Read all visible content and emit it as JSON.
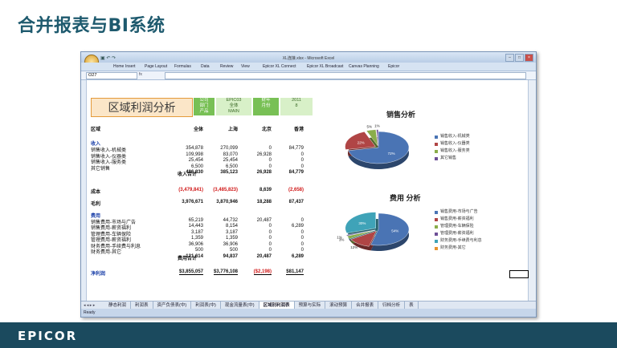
{
  "slide": {
    "title": "合并报表与BI系统",
    "logo": "EPICOR"
  },
  "window": {
    "title": "XL连接.xlsx - Microsoft Excel"
  },
  "ribbon_tabs": [
    "Home",
    "Insert",
    "Page Layout",
    "Formulas",
    "Data",
    "Review",
    "View",
    "Epicor XL Connect",
    "Epicor XL Broadcast",
    "Canvas Planning",
    "Epicor"
  ],
  "formula_bar": {
    "cell": "O27",
    "fx": "fx"
  },
  "report": {
    "title": "区域利润分析",
    "info": {
      "col1": [
        "公司",
        "部门",
        "产品"
      ],
      "col2": [
        "EPIC03",
        "全体",
        "MAIN"
      ],
      "col3": [
        "财年",
        "月份"
      ],
      "col4": [
        "2011",
        "8"
      ]
    },
    "headers": [
      "区域",
      "全体",
      "上海",
      "北京",
      "香港"
    ],
    "income_title": "收入",
    "income_rows": [
      {
        "label": "销售收入-机械类",
        "v": [
          "354,878",
          "270,099",
          "0",
          "84,779"
        ]
      },
      {
        "label": "销售收入-仪器类",
        "v": [
          "109,998",
          "83,070",
          "26,928",
          "0"
        ]
      },
      {
        "label": "销售收入-服务类",
        "v": [
          "25,454",
          "25,454",
          "0",
          "0"
        ]
      },
      {
        "label": "其它销售",
        "v": [
          "6,500",
          "6,500",
          "0",
          "0"
        ]
      }
    ],
    "income_total": {
      "label": "收入合计",
      "v": [
        "496,830",
        "385,123",
        "26,928",
        "84,779"
      ]
    },
    "cost": {
      "label": "成本",
      "v": [
        "(3,479,841)",
        "(3,485,823)",
        "8,639",
        "(2,658)"
      ]
    },
    "gross": {
      "label": "毛利",
      "v": [
        "3,976,671",
        "3,870,946",
        "18,288",
        "87,437"
      ]
    },
    "expense_title": "费用",
    "expense_rows": [
      {
        "label": "销售费用-市场与广告",
        "v": [
          "65,219",
          "44,732",
          "20,487",
          "0"
        ]
      },
      {
        "label": "销售费用-薪资福利",
        "v": [
          "14,443",
          "8,154",
          "0",
          "6,289"
        ]
      },
      {
        "label": "管理费用-车辆保险",
        "v": [
          "3,187",
          "3,187",
          "0",
          "0"
        ]
      },
      {
        "label": "管理费用-薪资福利",
        "v": [
          "1,359",
          "1,359",
          "0",
          "0"
        ]
      },
      {
        "label": "财务费用-手续费与利息",
        "v": [
          "36,906",
          "36,906",
          "0",
          "0"
        ]
      },
      {
        "label": "财务费用-其它",
        "v": [
          "500",
          "500",
          "0",
          "0"
        ]
      }
    ],
    "expense_total": {
      "label": "费用合计",
      "v": [
        "121,614",
        "94,837",
        "20,487",
        "6,289"
      ]
    },
    "net": {
      "label": "净利润",
      "v": [
        "$3,855,057",
        "$3,776,108",
        "($2,198)",
        "$81,147"
      ]
    }
  },
  "chart_data": [
    {
      "type": "pie",
      "title": "销售分析",
      "categories": [
        "销售收入-机械类",
        "销售收入-仪器类",
        "销售收入-服务类",
        "其它销售"
      ],
      "values": [
        72,
        22,
        5,
        1
      ],
      "labels": [
        "72%",
        "22%",
        "5%",
        "1%"
      ],
      "colors": [
        "#4a74b4",
        "#b04545",
        "#8aad4a",
        "#6d4f96"
      ]
    },
    {
      "type": "pie",
      "title": "费用 分析",
      "categories": [
        "销售费用-市场与广告",
        "销售费用-薪资福利",
        "管理费用-车辆保险",
        "管理费用-薪资福利",
        "财务费用-手续费与利息",
        "财务费用-其它"
      ],
      "values": [
        54,
        12,
        3,
        1,
        30,
        0
      ],
      "labels": [
        "54%",
        "12%",
        "3%",
        "1%",
        "30%",
        "0%"
      ],
      "colors": [
        "#4a74b4",
        "#b04545",
        "#8aad4a",
        "#6d4f96",
        "#3fa3b8",
        "#e8922e"
      ]
    }
  ],
  "sheet_tabs": [
    "静态利润",
    "利润表",
    "资产负债表(中)",
    "利润表(中)",
    "现金流量表(中)",
    "区域别利润表",
    "预算与实际",
    "滚动预算",
    "合并报表",
    "归档分析",
    "表"
  ],
  "active_tab": "区域别利润表",
  "status": "Ready"
}
